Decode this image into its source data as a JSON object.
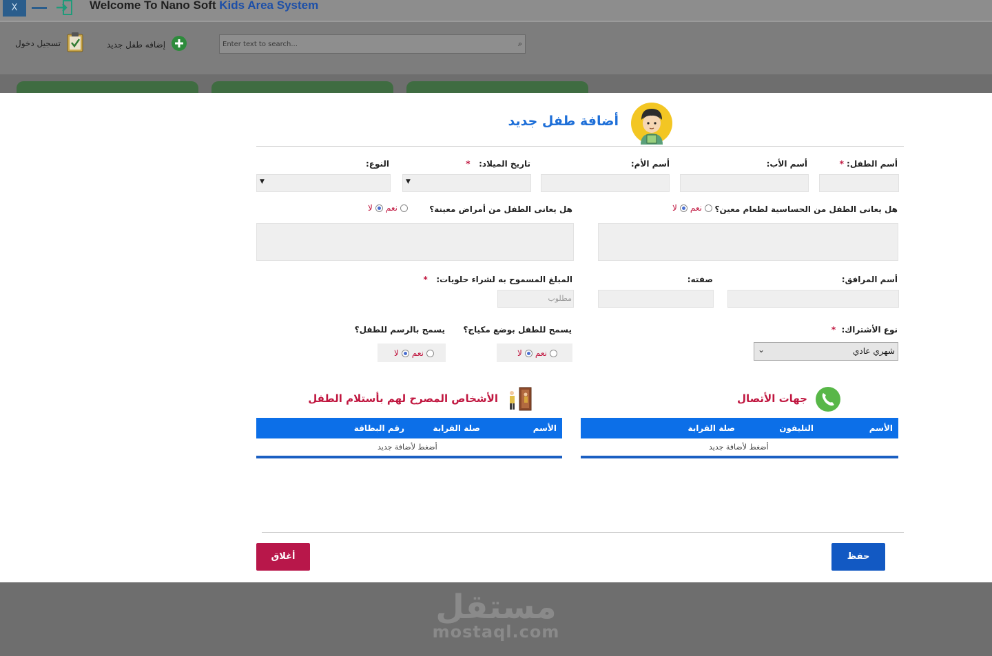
{
  "window": {
    "close_label": "X",
    "title_part1": "Welcome To Nano Soft ",
    "title_part2": "Kids Area System"
  },
  "toolbar": {
    "login_label": "تسجيل دخول",
    "add_child_label": "إضافه طفل جديد",
    "search_placeholder": "Enter text to search..."
  },
  "modal": {
    "title": "أضافة طفل جديد",
    "fields": {
      "child_name": "أسم الطفل:",
      "father_name": "أسم الأب:",
      "mother_name": "أسم  الأم:",
      "birth_date": "تاريخ الميلاد:",
      "gender": "النوع:",
      "food_allergy_q": "هل يعانى الطفل من الحساسية لطعام معين؟",
      "diseases_q": "هل يعانى الطفل من أمراض معينة؟",
      "companion_name": "أسم المرافق:",
      "relation": "صفته:",
      "sweets_amount": "المبلغ المسموح به لشراء حلويات:",
      "sweets_placeholder": "مطلوب",
      "subscription_type": "نوع الأشتراك:",
      "subscription_value": "شهري عادي",
      "makeup_q": "يسمح للطفل بوضع مكياج؟",
      "drawing_q": "يسمح بالرسم للطفل؟"
    },
    "required_mark": "*",
    "yes": "نعم",
    "no": "لا",
    "contacts": {
      "title": "جهات الأتصال",
      "columns": [
        "الأسم",
        "التليفون",
        "صلة القرابة"
      ],
      "hint": "أضغط لأضافة جديد"
    },
    "authorized": {
      "title": "الأشخاص المصرح لهم بأستلام الطفل",
      "columns": [
        "الأسم",
        "صلة القرابة",
        "رقم البطاقة"
      ],
      "hint": "أضغط لأضافة جديد"
    },
    "save_label": "حفظ",
    "close_label": "أغلاق"
  },
  "watermark": {
    "arabic": "مستقل",
    "latin": "mostaql.com"
  },
  "colors": {
    "primary_blue": "#0c6fe8",
    "title_blue": "#1e6fd8",
    "accent_red": "#c0163f",
    "save_button": "#1259c3",
    "close_button": "#b8174a"
  }
}
